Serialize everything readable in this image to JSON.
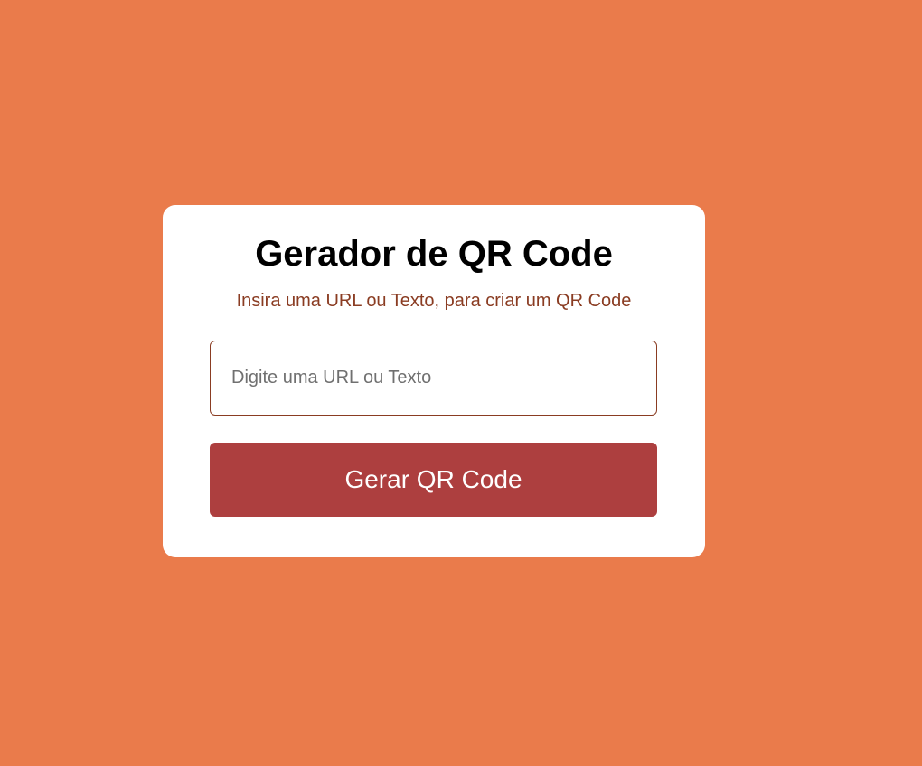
{
  "colors": {
    "background": "#ea7b4b",
    "card": "#ffffff",
    "subtitle_text": "#8a3c22",
    "input_border": "#8a3c22",
    "button_background": "#ad3f3f",
    "button_text": "#ffffff"
  },
  "card": {
    "title": "Gerador de QR Code",
    "subtitle": "Insira uma URL ou Texto, para criar um QR Code"
  },
  "form": {
    "input_value": "",
    "input_placeholder": "Digite uma URL ou Texto",
    "button_label": "Gerar QR Code"
  }
}
